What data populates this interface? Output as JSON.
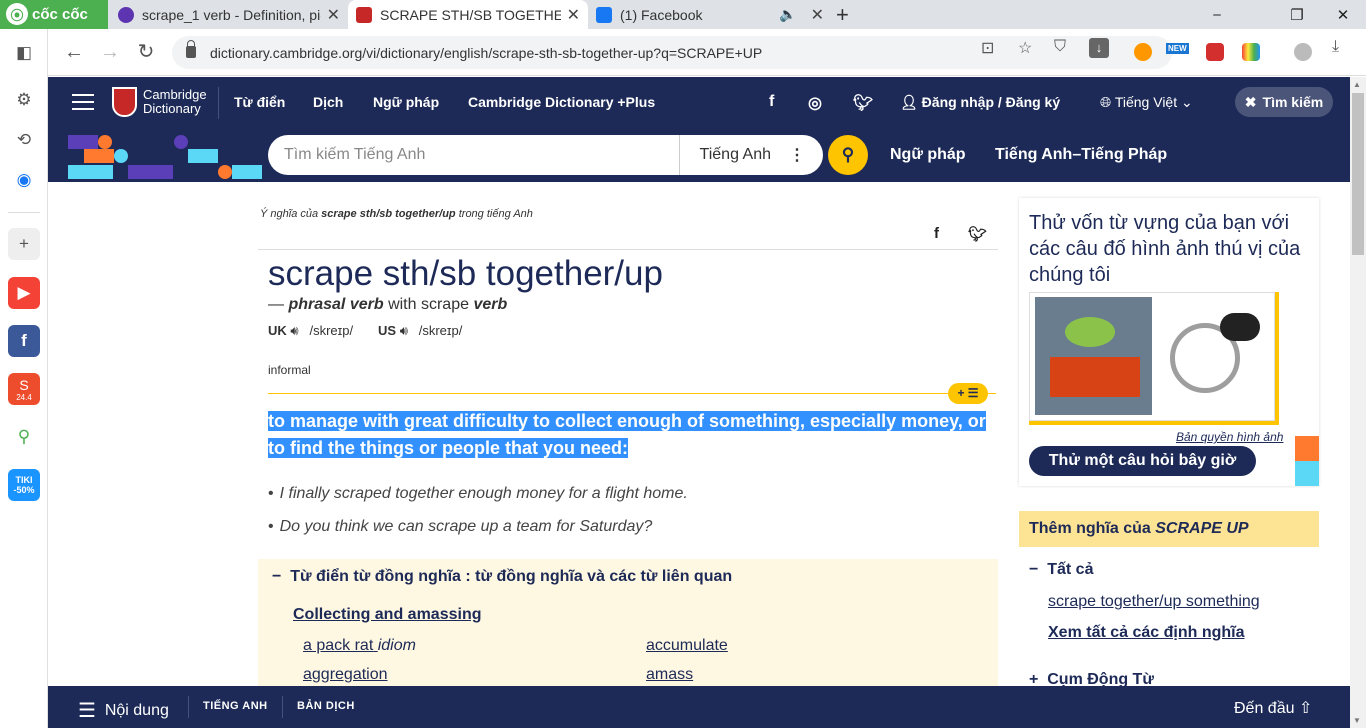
{
  "browser": {
    "brand": "cốc cốc",
    "tabs": [
      {
        "title": "scrape_1 verb - Definition, pic"
      },
      {
        "title": "SCRAPE STH/SB TOGETHER/U"
      },
      {
        "title": "(1) Facebook"
      }
    ],
    "url": "dictionary.cambridge.org/vi/dictionary/english/scrape-sth-sb-together-up?q=SCRAPE+UP",
    "new_badge": "NEW"
  },
  "sidebar": {
    "badges": {
      "shopee": "24.4",
      "tiki": "TIKI -50%"
    }
  },
  "header": {
    "logo_line1": "Cambridge",
    "logo_line2": "Dictionary",
    "nav": [
      "Từ điển",
      "Dịch",
      "Ngữ pháp",
      "Cambridge Dictionary +Plus"
    ],
    "login": "Đăng nhập / Đăng ký",
    "language": "Tiếng Việt",
    "close_search": "Tìm kiếm"
  },
  "search": {
    "placeholder": "Tìm kiếm Tiếng Anh",
    "dictionary": "Tiếng Anh",
    "links": [
      "Ngữ pháp",
      "Tiếng Anh–Tiếng Pháp"
    ]
  },
  "entry": {
    "crumb_prefix": "Ý nghĩa của",
    "crumb_term": "scrape sth/sb together/up",
    "crumb_suffix": "trong tiếng Anh",
    "headword": "scrape sth/sb together/up",
    "pos_dash": "—",
    "pos": "phrasal verb",
    "pos_with": "with scrape",
    "pos_verb": "verb",
    "uk_label": "UK",
    "uk_ipa": "/skreɪp/",
    "us_label": "US",
    "us_ipa": "/skreɪp/",
    "register": "informal",
    "plus_list": "+ ☰",
    "definition": "to manage with great difficulty to collect enough of something, especially money, or to find the things or people that you need:",
    "examples": [
      "I finally scraped together enough money for a flight home.",
      "Do you think we can scrape up a team for Saturday?"
    ]
  },
  "thesaurus": {
    "heading": "Từ điển từ đồng nghĩa : từ đồng nghĩa và các từ liên quan",
    "category": "Collecting and amassing",
    "words": [
      {
        "word": "a pack rat",
        "tag": "idiom"
      },
      {
        "word": "accumulate",
        "tag": ""
      },
      {
        "word": "aggregation",
        "tag": ""
      },
      {
        "word": "amass",
        "tag": ""
      }
    ]
  },
  "right": {
    "quiz_text": "Thử vốn từ vựng của bạn với các câu đố hình ảnh thú vị của chúng tôi",
    "copyright": "Bản quyền hình ảnh",
    "quiz_button": "Thử một câu hỏi bây giờ",
    "more_prefix": "Thêm nghĩa của",
    "more_term": "SCRAPE UP",
    "all_label": "Tất cả",
    "link1": "scrape together/up something",
    "see_all": "Xem tất cả các định nghĩa",
    "phrasal_label": "Cụm Động Từ"
  },
  "bottom": {
    "contents": "Nội dung",
    "english": "TIẾNG ANH",
    "translation": "BẢN DỊCH",
    "to_top": "Đến đầu"
  },
  "colors": {
    "navy": "#1d2a57",
    "yellow": "#fec400",
    "highlight": "#3390ff",
    "thesaurus_bg": "#fef7e1"
  }
}
